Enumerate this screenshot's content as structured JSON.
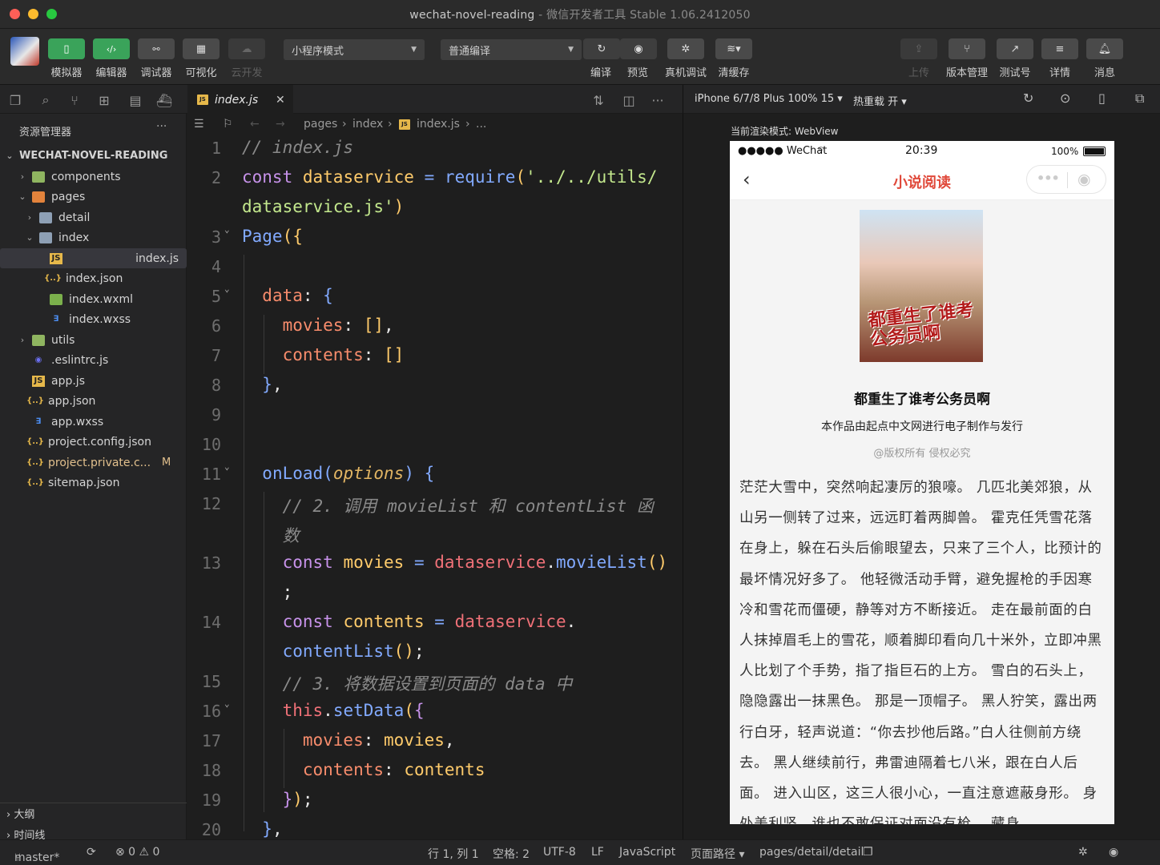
{
  "window": {
    "title": "wechat-novel-reading",
    "subtitle": "微信开发者工具 Stable 1.06.2412050"
  },
  "toolbar": {
    "left_buttons": [
      {
        "label": "模拟器",
        "icon": "phone-icon",
        "style": "green"
      },
      {
        "label": "编辑器",
        "icon": "code-icon",
        "style": "green"
      },
      {
        "label": "调试器",
        "icon": "debug-icon",
        "style": "gray"
      },
      {
        "label": "可视化",
        "icon": "layout-icon",
        "style": "gray"
      },
      {
        "label": "云开发",
        "icon": "cloud-icon",
        "style": "disabled"
      }
    ],
    "mode_select": "小程序模式",
    "compile_select": "普通编译",
    "mid_buttons": [
      {
        "label": "编译",
        "icon": "refresh-icon"
      },
      {
        "label": "预览",
        "icon": "eye-icon"
      },
      {
        "label": "真机调试",
        "icon": "bug-icon"
      },
      {
        "label": "清缓存",
        "icon": "layers-icon"
      }
    ],
    "right_buttons": [
      {
        "label": "上传",
        "icon": "upload-icon",
        "disabled": true
      },
      {
        "label": "版本管理",
        "icon": "branch-icon"
      },
      {
        "label": "测试号",
        "icon": "external-icon"
      },
      {
        "label": "详情",
        "icon": "menu-icon"
      },
      {
        "label": "消息",
        "icon": "bell-icon"
      }
    ]
  },
  "editor_tab": {
    "label": "index.js"
  },
  "sidebar": {
    "header": "资源管理器",
    "more": "···",
    "project": "WECHAT-NOVEL-READING",
    "items": [
      {
        "label": "components",
        "kind": "folder-green",
        "depth": 1,
        "chev": "›"
      },
      {
        "label": "pages",
        "kind": "folder-orange",
        "depth": 1,
        "chev": "⌄"
      },
      {
        "label": "detail",
        "kind": "folder",
        "depth": 2,
        "chev": "›"
      },
      {
        "label": "index",
        "kind": "folder",
        "depth": 2,
        "chev": "⌄"
      },
      {
        "label": "index.js",
        "kind": "js",
        "depth": 3,
        "selected": true
      },
      {
        "label": "index.json",
        "kind": "json",
        "depth": 3
      },
      {
        "label": "index.wxml",
        "kind": "wxml",
        "depth": 3
      },
      {
        "label": "index.wxss",
        "kind": "wxss",
        "depth": 3
      },
      {
        "label": "utils",
        "kind": "folder-green",
        "depth": 1,
        "chev": "›"
      },
      {
        "label": ".eslintrc.js",
        "kind": "eslint",
        "depth": 1
      },
      {
        "label": "app.js",
        "kind": "js",
        "depth": 1
      },
      {
        "label": "app.json",
        "kind": "json",
        "depth": 1
      },
      {
        "label": "app.wxss",
        "kind": "wxss",
        "depth": 1
      },
      {
        "label": "project.config.json",
        "kind": "json",
        "depth": 1
      },
      {
        "label": "project.private.c...",
        "kind": "json",
        "depth": 1,
        "badge": "M"
      },
      {
        "label": "sitemap.json",
        "kind": "json",
        "depth": 1
      }
    ],
    "outline": "大纲",
    "timeline": "时间线"
  },
  "breadcrumb": [
    "pages",
    "index",
    "index.js",
    "..."
  ],
  "code_lines": [
    "1",
    "2",
    "",
    "3",
    "4",
    "5",
    "6",
    "7",
    "8",
    "9",
    "10",
    "11",
    "12",
    "",
    "13",
    "",
    "14",
    "",
    "15",
    "16",
    "17",
    "18",
    "19",
    "20"
  ],
  "preview": {
    "device": "iPhone 6/7/8 Plus 100% 15 ▾",
    "hot_reload": "热重载 开 ▾",
    "render_mode": "当前渲染模式: WebView",
    "phone_status": {
      "carrier": "●●●●● WeChat",
      "time": "20:39",
      "battery": "100%"
    },
    "nav_title": "小说阅读",
    "book_title": "都重生了谁考公务员啊",
    "cover_text": "都重生了谁考公务员啊",
    "publisher": "本作品由起点中文网进行电子制作与发行",
    "copyright": "@版权所有 侵权必究",
    "content": "茫茫大雪中，突然响起凄厉的狼嚎。 几匹北美郊狼，从山另一侧转了过来，远远盯着两脚兽。 霍克任凭雪花落在身上，躲在石头后偷眼望去，只来了三个人，比预计的最坏情况好多了。 他轻微活动手臂，避免握枪的手因寒冷和雪花而僵硬，静等对方不断接近。 走在最前面的白人抹掉眉毛上的雪花，顺着脚印看向几十米外，立即冲黑人比划了个手势，指了指巨石的上方。 雪白的石头上，隐隐露出一抹黑色。 那是一顶帽子。 黑人狞笑，露出两行白牙，轻声说道：“你去抄他后路。”白人往侧前方绕去。 黑人继续前行，弗雷迪隔着七八米，跟在白人后面。 进入山区，这三人很小心，一直注意遮蔽身形。 身处美利坚，谁也不敢保证对面没有枪。 藏身"
  },
  "statusbar": {
    "branch": "master*",
    "problems": "⊗ 0 ⚠ 0",
    "position": "行 1, 列 1",
    "spaces": "空格: 2",
    "encoding": "UTF-8",
    "eol": "LF",
    "language": "JavaScript",
    "page_path_label": "页面路径 ▾",
    "page_path": "pages/detail/detail"
  }
}
